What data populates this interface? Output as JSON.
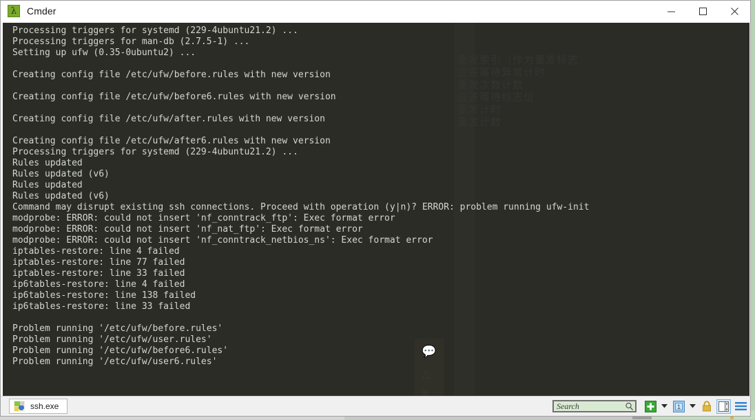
{
  "window": {
    "app_icon": "lambda-icon",
    "title": "Cmder",
    "controls": {
      "minimize": "minimize-icon",
      "maximize": "maximize-icon",
      "close": "close-icon"
    }
  },
  "terminal": {
    "lines": [
      "Processing triggers for systemd (229-4ubuntu21.2) ...",
      "Processing triggers for man-db (2.7.5-1) ...",
      "Setting up ufw (0.35-0ubuntu2) ...",
      "",
      "Creating config file /etc/ufw/before.rules with new version",
      "",
      "Creating config file /etc/ufw/before6.rules with new version",
      "",
      "Creating config file /etc/ufw/after.rules with new version",
      "",
      "Creating config file /etc/ufw/after6.rules with new version",
      "Processing triggers for systemd (229-4ubuntu21.2) ...",
      "Rules updated",
      "Rules updated (v6)",
      "Rules updated",
      "Rules updated (v6)",
      "Command may disrupt existing ssh connections. Proceed with operation (y|n)? ERROR: problem running ufw-init",
      "modprobe: ERROR: could not insert 'nf_conntrack_ftp': Exec format error",
      "modprobe: ERROR: could not insert 'nf_nat_ftp': Exec format error",
      "modprobe: ERROR: could not insert 'nf_conntrack_netbios_ns': Exec format error",
      "iptables-restore: line 4 failed",
      "iptables-restore: line 77 failed",
      "iptables-restore: line 33 failed",
      "ip6tables-restore: line 4 failed",
      "ip6tables-restore: line 138 failed",
      "ip6tables-restore: line 33 failed",
      "",
      "Problem running '/etc/ufw/before.rules'",
      "Problem running '/etc/ufw/user.rules'",
      "Problem running '/etc/ufw/before6.rules'",
      "Problem running '/etc/ufw/user6.rules'"
    ],
    "background_color": "#2c2c27",
    "text_color": "#d3d7cf",
    "ghost_text": "重发索引（作为重发标志\n应答等待异常计时\n重发次数计数\n应答等待标志位\n重发计时\n重发计数"
  },
  "statusbar": {
    "tab": {
      "label": "ssh.exe",
      "icon": "console-app-icon"
    },
    "search": {
      "placeholder": "Search",
      "value": "",
      "icon": "search-icon"
    },
    "buttons": {
      "new_console": "plus-icon",
      "new_console_caret": "chevron-down-icon",
      "active_console": "1",
      "active_console_caret": "chevron-down-icon",
      "lock": "padlock-icon",
      "split_pane": "split-pane-icon",
      "menu": "hamburger-menu-icon"
    },
    "colors": {
      "plus_green": "#34a832",
      "tab_blue": "#5a9bd5",
      "lock_gold": "#d3a41e",
      "menu_blue": "#2f7fd0"
    }
  }
}
